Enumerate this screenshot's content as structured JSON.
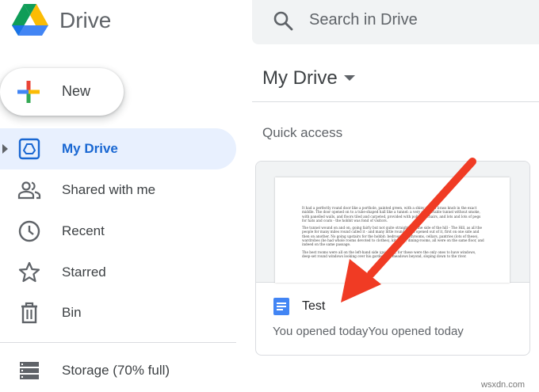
{
  "header": {
    "app_name": "Drive",
    "search_placeholder": "Search in Drive"
  },
  "sidebar": {
    "new_label": "New",
    "items": [
      {
        "label": "My Drive",
        "icon": "my-drive-icon",
        "active": true
      },
      {
        "label": "Shared with me",
        "icon": "shared-with-me-icon",
        "active": false
      },
      {
        "label": "Recent",
        "icon": "clock-icon",
        "active": false
      },
      {
        "label": "Starred",
        "icon": "star-icon",
        "active": false
      },
      {
        "label": "Bin",
        "icon": "trash-icon",
        "active": false
      }
    ],
    "storage_label": "Storage (70% full)"
  },
  "main": {
    "title": "My Drive",
    "section_heading": "Quick access",
    "cards": [
      {
        "file_name": "Test",
        "meta": "You opened todayYou opened today",
        "preview_paragraphs": [
          "It had a perfectly round door like a porthole, painted green, with a shiny yellow brass knob in the exact middle. The door opened on to a tube-shaped hall like a tunnel: a very comfortable tunnel without smoke, with panelled walls, and floors tiled and carpeted, provided with polished chairs, and lots and lots of pegs for hats and coats - the hobbit was fond of visitors.",
          "The tunnel wound on and on, going fairly but not quite straight into the side of the hill - The Hill, as all the people for many miles round called it - and many little round doors opened out of it, first on one side and then on another. No going upstairs for the hobbit: bedrooms, bathrooms, cellars, pantries (lots of these), wardrobes (he had whole rooms devoted to clothes), kitchens, dining-rooms, all were on the same floor, and indeed on the same passage.",
          "The best rooms were all on the left-hand side (going in), for these were the only ones to have windows, deep-set round windows looking over his garden and meadows beyond, sloping down to the river."
        ]
      }
    ]
  },
  "annotation": {
    "type": "red-arrow",
    "color": "#f03b24"
  },
  "watermark": "wsxdn.com",
  "colors": {
    "accent": "#1967d2",
    "active_bg": "#e8f0fe",
    "search_bg": "#f1f3f4",
    "arrow": "#f03b24"
  }
}
